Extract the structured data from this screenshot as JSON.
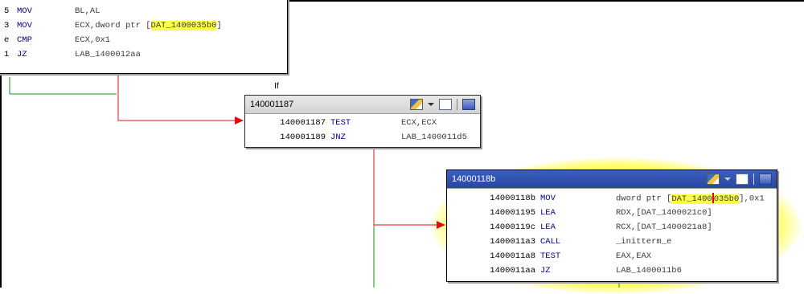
{
  "block_a": {
    "rows": [
      {
        "addr": "5",
        "mnem": "MOV",
        "opnd_pre": "BL,AL",
        "hl": "",
        "opnd_post": ""
      },
      {
        "addr": "3",
        "mnem": "MOV",
        "opnd_pre": "ECX,dword ptr [",
        "hl": "DAT_1400035b0",
        "opnd_post": "]"
      },
      {
        "addr": "e",
        "mnem": "CMP",
        "opnd_pre": "ECX,0x1",
        "hl": "",
        "opnd_post": ""
      },
      {
        "addr": "1",
        "mnem": "JZ",
        "opnd_pre": "LAB_1400012aa",
        "hl": "",
        "opnd_post": ""
      }
    ]
  },
  "branch_label": "If",
  "block_b": {
    "title": "140001187",
    "rows": [
      {
        "addr": "140001187",
        "mnem": "TEST",
        "opnd": "ECX,ECX"
      },
      {
        "addr": "140001189",
        "mnem": "JNZ",
        "opnd": "LAB_1400011d5"
      }
    ]
  },
  "block_c": {
    "title": "14000118b",
    "row1": {
      "addr": "14000118b",
      "mnem": "MOV",
      "opnd_pre": "dword ptr [",
      "hl_a": "DAT_1400",
      "hl_b": "035b0",
      "opnd_post": "],0x1"
    },
    "rows": [
      {
        "addr": "140001195",
        "mnem": "LEA",
        "opnd": "RDX,[DAT_1400021c0]"
      },
      {
        "addr": "14000119c",
        "mnem": "LEA",
        "opnd": "RCX,[DAT_1400021a8]"
      },
      {
        "addr": "1400011a3",
        "mnem": "CALL",
        "opnd": "_initterm_e"
      },
      {
        "addr": "1400011a8",
        "mnem": "TEST",
        "opnd": "EAX,EAX"
      },
      {
        "addr": "1400011aa",
        "mnem": "JZ",
        "opnd": "LAB_1400011b6"
      }
    ]
  },
  "colors": {
    "edge_taken": "#e01010",
    "edge_fallthrough": "#109010",
    "highlight": "#ffff44",
    "glow": "#ffff33",
    "active_header": "#2f50ad"
  },
  "icons": [
    "pencil-icon",
    "chevron-down-icon",
    "window-icon",
    "snapshot-icon"
  ]
}
